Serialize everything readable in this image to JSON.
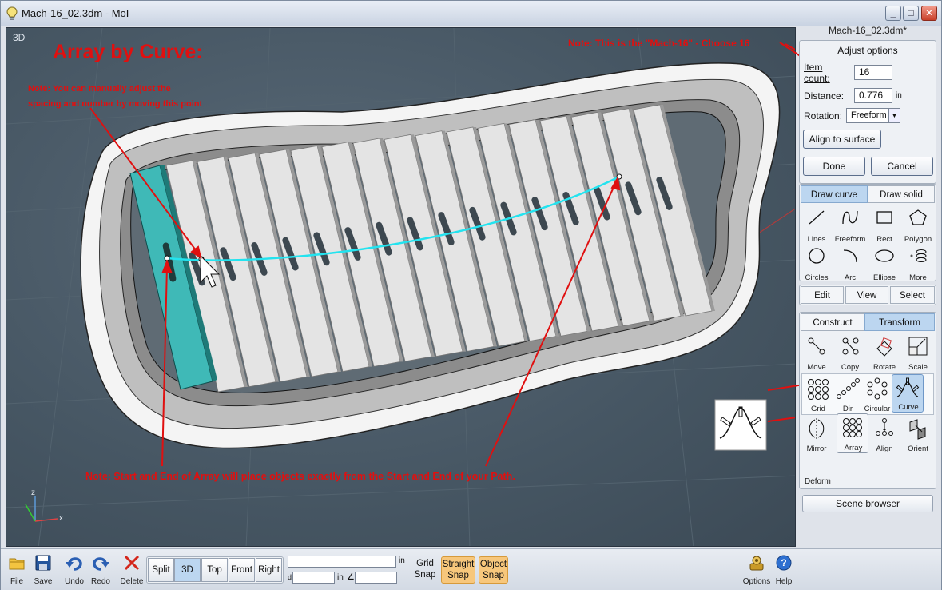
{
  "window": {
    "title": "Mach-16_02.3dm - MoI",
    "minimize": "_",
    "maximize": "□",
    "close": "✕"
  },
  "viewport": {
    "label": "3D",
    "axis_z": "z",
    "axis_x": "x",
    "annotations": {
      "heading": "Array by Curve:",
      "note_spacing_line1": "Note: You can manually adjust the",
      "note_spacing_line2": "spacing and number by moving this point",
      "note_mach": "Note: This is the \"Mach-16\" - Choose 16",
      "note_start_end": "Note: Start and End of Array will place objects exactly from the Start and End of your Path."
    },
    "colors": {
      "annotation": "#e01010",
      "curve": "#23e3ef",
      "selected_slat": "#3fb9b7"
    }
  },
  "panel": {
    "doc_name": "Mach-16_02.3dm*",
    "options": {
      "heading": "Adjust options",
      "item_count_label1": "Item",
      "item_count_label2": "count:",
      "item_count_value": "16",
      "distance_label": "Distance:",
      "distance_value": "0.776",
      "distance_unit": "in",
      "rotation_label": "Rotation:",
      "rotation_value": "Freeform",
      "align_button": "Align to surface",
      "done_button": "Done",
      "cancel_button": "Cancel"
    },
    "draw_tabs": [
      "Draw curve",
      "Draw solid"
    ],
    "draw_tools": [
      "Lines",
      "Freeform",
      "Rect",
      "Polygon",
      "Circles",
      "Arc",
      "Ellipse",
      "More"
    ],
    "mid_tabs": [
      "Edit",
      "View",
      "Select"
    ],
    "transform_tabs": [
      "Construct",
      "Transform"
    ],
    "transform_tools": [
      "Move",
      "Copy",
      "Rotate",
      "Scale"
    ],
    "array_tools": [
      "Grid",
      "Dir",
      "Circular",
      "Curve"
    ],
    "more_tools": [
      "Mirror",
      "Array",
      "Align",
      "Orient"
    ],
    "deform_label": "Deform",
    "scene_browser": "Scene browser"
  },
  "toolbar": {
    "file": "File",
    "save": "Save",
    "undo": "Undo",
    "redo": "Redo",
    "delete": "Delete",
    "views": [
      "Split",
      "3D",
      "Top",
      "Front",
      "Right"
    ],
    "active_view": "3D",
    "unit_in": "in",
    "unit_d": "d",
    "unit_in2": "in",
    "angle_symbol": "∠",
    "grid_snap_line1": "Grid",
    "grid_snap_line2": "Snap",
    "straight_snap_line1": "Straight",
    "straight_snap_line2": "Snap",
    "object_snap_line1": "Object",
    "object_snap_line2": "Snap",
    "options": "Options",
    "help": "Help"
  }
}
